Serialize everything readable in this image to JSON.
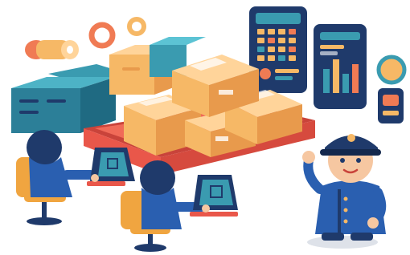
{
  "scene": {
    "description_tags": [
      "warehouse",
      "inventory",
      "logistics",
      "operators",
      "dashboard",
      "security-guard"
    ],
    "palette": {
      "navy": "#1f3a6b",
      "blue": "#2a5fb0",
      "teal": "#3a9bb0",
      "orange": "#f07b54",
      "box": "#f6b866",
      "box_dark": "#e89a4c",
      "box_light": "#ffd49a",
      "tray": "#e9574a",
      "skin": "#f6c7a1",
      "chair": "#f0a540",
      "paper": "#f8efe0"
    }
  }
}
